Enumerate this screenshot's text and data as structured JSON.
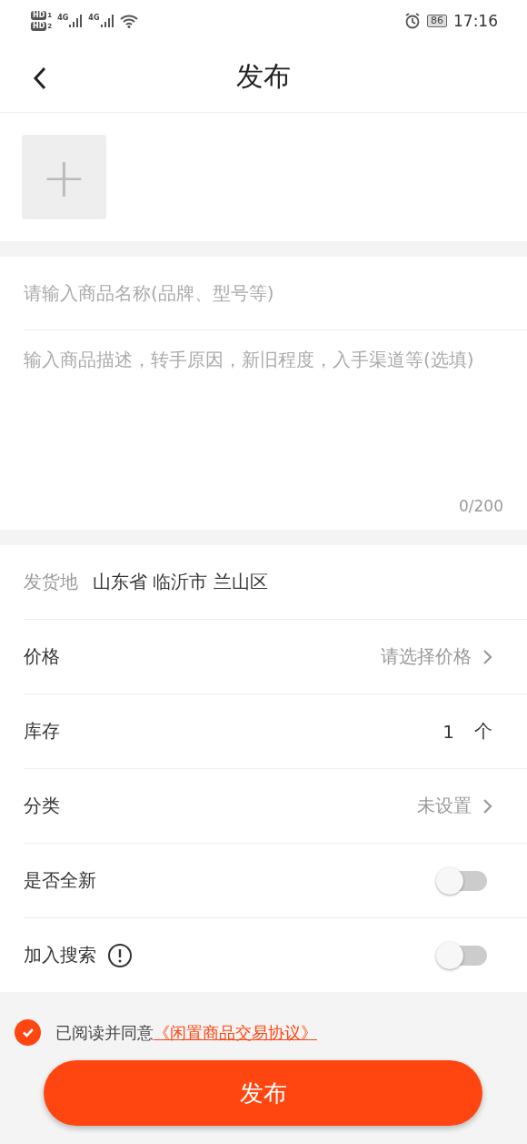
{
  "status_bar": {
    "sims": [
      {
        "label": "HD",
        "slot": "1"
      },
      {
        "label": "HD",
        "slot": "2"
      }
    ],
    "networks": [
      "4G",
      "4G"
    ],
    "battery": "86",
    "time": "17:16"
  },
  "header": {
    "title": "发布"
  },
  "photos": {
    "add_label": "+"
  },
  "name_field": {
    "placeholder": "请输入商品名称(品牌、型号等)"
  },
  "description_field": {
    "placeholder": "输入商品描述，转手原因，新旧程度，入手渠道等(选填)",
    "counter": "0/200"
  },
  "rows": [
    {
      "kind": "location",
      "label": "发货地",
      "value": "山东省 临沂市 兰山区"
    },
    {
      "kind": "select",
      "label": "价格",
      "placeholder": "请选择价格"
    },
    {
      "kind": "stepper",
      "label": "库存",
      "value": "1",
      "unit": "个"
    },
    {
      "kind": "select",
      "label": "分类",
      "placeholder": "未设置"
    },
    {
      "kind": "toggle",
      "label": "是否全新",
      "on": false,
      "info": false
    },
    {
      "kind": "toggle",
      "label": "加入搜索",
      "on": false,
      "info": true
    }
  ],
  "agreement": {
    "checked": true,
    "text": "已阅读并同意",
    "link": "《闲置商品交易协议》"
  },
  "submit_button": "发布"
}
